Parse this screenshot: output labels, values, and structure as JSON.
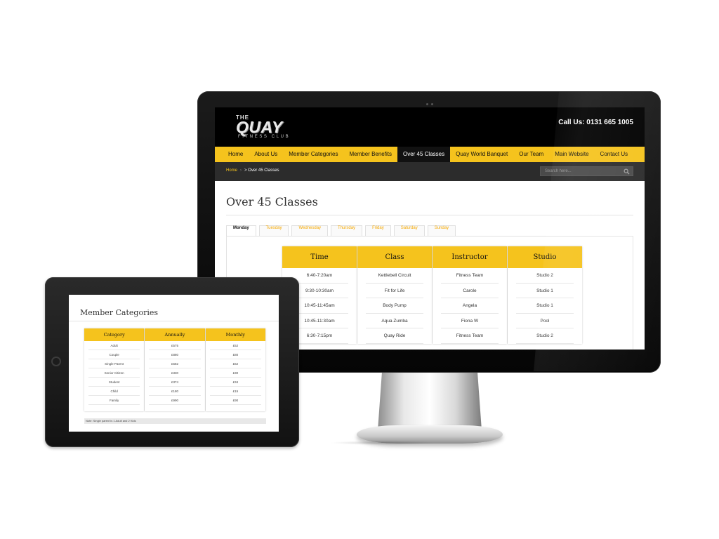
{
  "desktop": {
    "logo": {
      "top": "THE",
      "main": "QUAY",
      "sub": "FITNESS CLUB"
    },
    "call": "Call Us: 0131 665 1005",
    "nav": [
      "Home",
      "About Us",
      "Member Categories",
      "Member Benefits",
      "Over 45 Classes",
      "Quay World Banquet",
      "Our Team",
      "Main Website",
      "Contact Us"
    ],
    "nav_active_index": 4,
    "breadcrumb": {
      "home": "Home",
      "sep": "›",
      "current": "> Over 45 Classes"
    },
    "search_placeholder": "Search here...",
    "page_title": "Over 45 Classes",
    "tabs": [
      "Monday",
      "Tuesday",
      "Wednesday",
      "Thursday",
      "Friday",
      "Saturday",
      "Sunday"
    ],
    "tabs_active_index": 0,
    "schedule": {
      "headers": [
        "Time",
        "Class",
        "Instructor",
        "Studio"
      ],
      "rows": [
        [
          "6:40-7:20am",
          "Kettlebell Circuit",
          "Fitness Team",
          "Studio 2"
        ],
        [
          "9:30-10:30am",
          "Fit for Life",
          "Carole",
          "Studio 1"
        ],
        [
          "10:45-11:45am",
          "Body Pump",
          "Angela",
          "Studio 1"
        ],
        [
          "10:45-11:30am",
          "Aqua Zumba",
          "Fiona W",
          "Pool"
        ],
        [
          "6:30-7:15pm",
          "Quay Ride",
          "Fitness Team",
          "Studio 2"
        ]
      ]
    },
    "accent_color": "#f5c31d"
  },
  "tablet": {
    "page_title": "Member Categories",
    "table": {
      "headers": [
        "Category",
        "Annually",
        "Monthly"
      ],
      "rows": [
        [
          "Adult",
          "£575",
          "£52"
        ],
        [
          "Couple",
          "£880",
          "£80"
        ],
        [
          "Single Parent",
          "£682",
          "£62"
        ],
        [
          "Senior Citizen",
          "£330",
          "£30"
        ],
        [
          "Student",
          "£374",
          "£34"
        ],
        [
          "Child",
          "£180",
          "£15"
        ],
        [
          "Family",
          "£990",
          "£90"
        ]
      ]
    },
    "note": "Note: Single parent is 1 Adult and 2 Kids"
  }
}
